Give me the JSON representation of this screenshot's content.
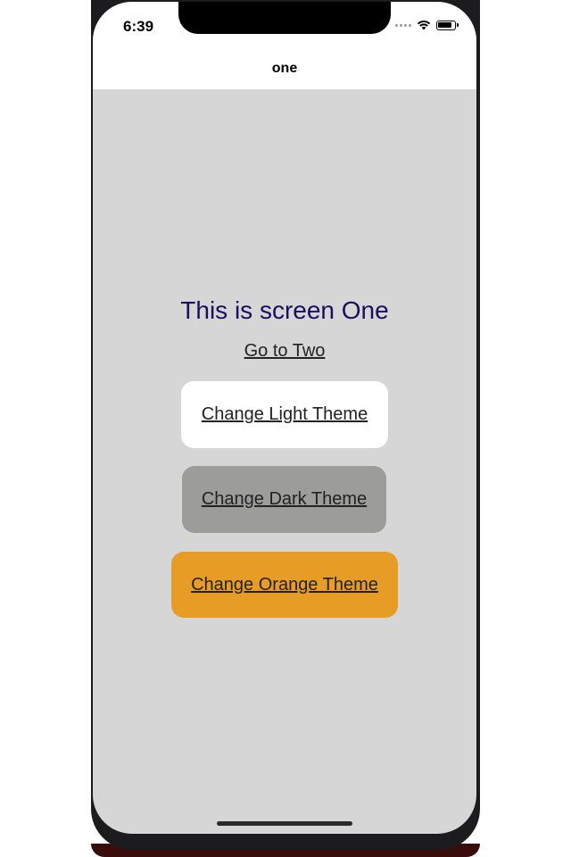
{
  "status_bar": {
    "time": "6:39",
    "icons": [
      "signal-icon",
      "wifi-icon",
      "battery-icon"
    ]
  },
  "nav": {
    "title": "one"
  },
  "main": {
    "title": "This is screen One",
    "link_label": "Go to Two",
    "buttons": [
      {
        "label": "Change Light Theme",
        "color": "#ffffff"
      },
      {
        "label": "Change Dark Theme",
        "color": "#9c9c98"
      },
      {
        "label": "Change Orange Theme",
        "color": "#e79c25"
      }
    ]
  },
  "colors": {
    "background": "#d6d6d6",
    "title_text": "#1a0f5e"
  }
}
